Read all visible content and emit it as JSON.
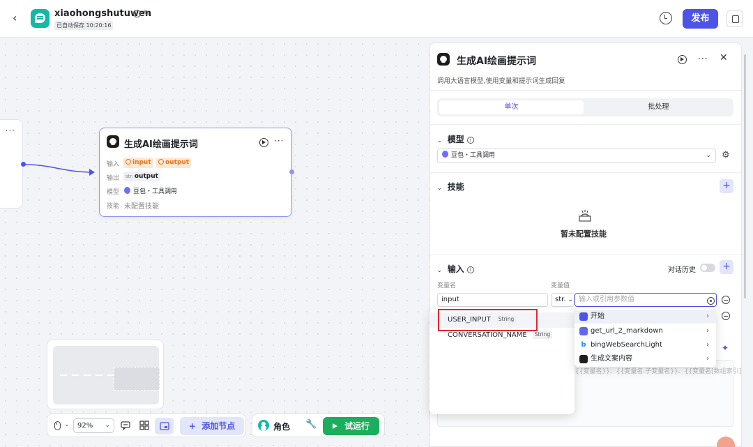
{
  "header": {
    "back_icon": "chevron-left-icon",
    "app_name": "xiaohongshutuwen",
    "saved_status": "已自动保存 10:20:16",
    "publish_label": "发布"
  },
  "canvas": {
    "node": {
      "title": "生成AI绘画提示词",
      "input_label": "输入",
      "input_tags": [
        "input",
        "output"
      ],
      "output_label": "输出",
      "output_type": "str.",
      "output_value": "output",
      "model_label": "模型",
      "model_value": "豆包・工具调用",
      "skill_label": "技能",
      "skill_value": "未配置技能"
    },
    "toolbar": {
      "zoom": "92%",
      "add_node_label": "添加节点",
      "role_label": "角色",
      "run_label": "试运行"
    }
  },
  "panel": {
    "title": "生成AI绘画提示词",
    "description": "调用大语言模型,使用变量和提示词生成回复",
    "tabs": [
      "单次",
      "批处理"
    ],
    "active_tab": "单次",
    "model_section": "模型",
    "model_value": "豆包・工具调用",
    "skill_section": "技能",
    "skill_empty": "暂未配置技能",
    "input_section": "输入",
    "history_label": "对话历史",
    "col_var_name": "变量名",
    "col_var_value": "变量值",
    "row": {
      "name": "input",
      "type": "str.",
      "value_placeholder": "输入或引用参数值"
    },
    "background_hint": "{{变量名}}、{{变量名.子变量名}}、{{变量名[数组索引]}}的方式引用输"
  },
  "dropdown_vars": [
    {
      "name": "USER_INPUT",
      "type": "String"
    },
    {
      "name": "CONVERSATION_NAME",
      "type": "String"
    }
  ],
  "dropdown_nodes": [
    {
      "name": "开始",
      "icon": "start-icon"
    },
    {
      "name": "get_url_2_markdown",
      "icon": "plugin-icon"
    },
    {
      "name": "bingWebSearchLight",
      "icon": "bing-icon"
    },
    {
      "name": "生成文案内容",
      "icon": "llm-icon"
    }
  ],
  "colors": {
    "accent": "#4d53e8",
    "run_green": "#1bae5c",
    "warn_orange": "#e8741b",
    "highlight_red": "#e0282e"
  }
}
